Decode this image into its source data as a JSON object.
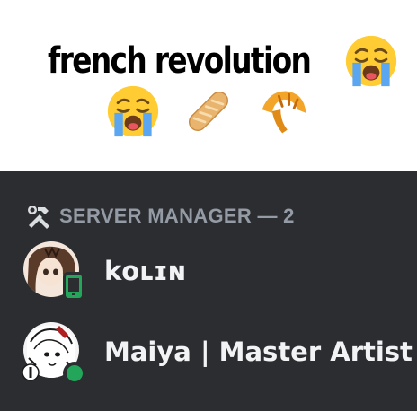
{
  "caption": {
    "line1_text": "french revolution",
    "line1_emoji": "loudly-crying-face",
    "line2_emojis": [
      "loudly-crying-face",
      "baguette-bread",
      "croissant"
    ]
  },
  "member_list": {
    "role": {
      "icon": "hammer-wrench-icon",
      "label": "SERVER MANAGER — 2"
    },
    "members": [
      {
        "name": "kolin",
        "display_name": "kᴏʟɪɴ",
        "status": "mobile-online",
        "status_color": "#23a55a"
      },
      {
        "name": "Maiya | Master Artist",
        "display_name": "Maiya | Master Artist",
        "status": "online",
        "status_color": "#23a55a"
      }
    ]
  },
  "colors": {
    "panel_bg": "#2b2d31",
    "role_label": "#949ba4",
    "member_name": "#f2f3f5",
    "online": "#23a55a"
  }
}
